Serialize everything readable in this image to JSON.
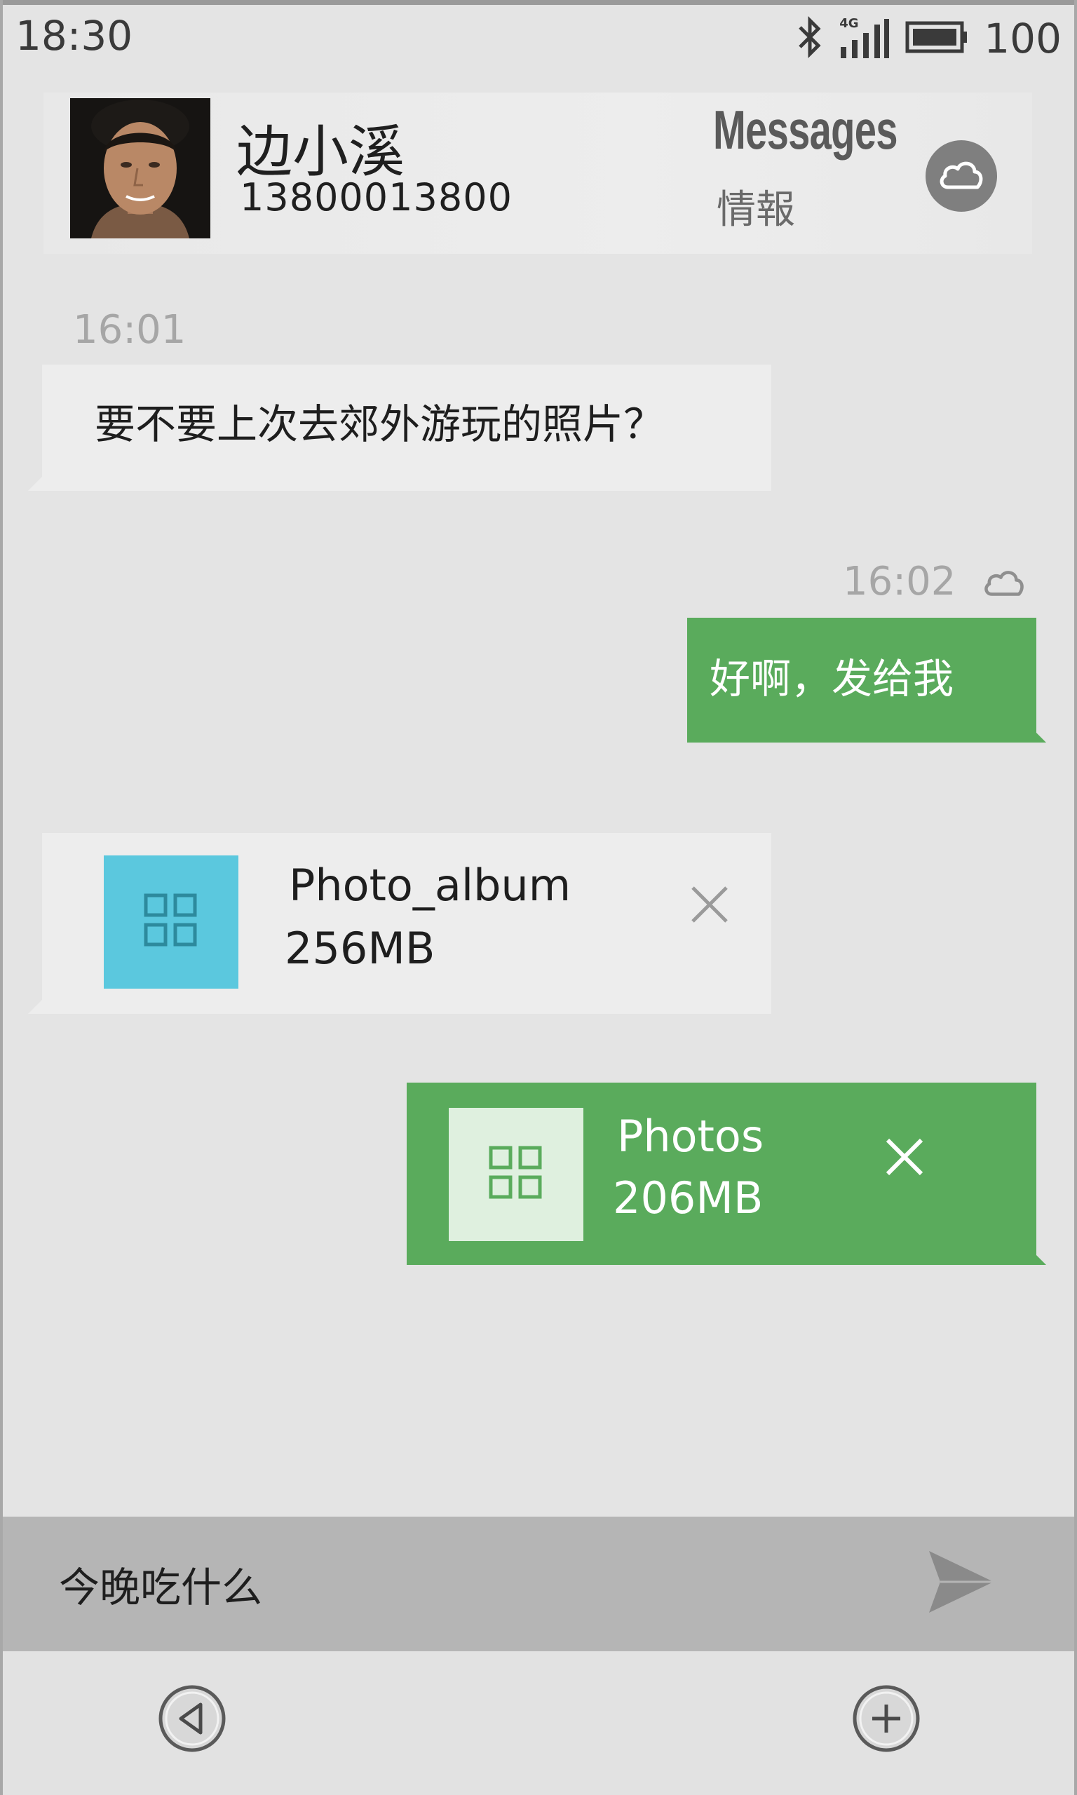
{
  "status_bar": {
    "time": "18:30",
    "network": "4G",
    "battery": "100",
    "icons": [
      "bluetooth-icon",
      "signal-icon",
      "battery-icon"
    ]
  },
  "header": {
    "contact_name": "边小溪",
    "contact_number": "13800013800",
    "app_title": "Messages",
    "app_subtitle": "情報",
    "cloud_icon": "cloud-icon"
  },
  "messages": [
    {
      "time": "16:01",
      "direction": "incoming",
      "text": "要不要上次去郊外游玩的照片？"
    },
    {
      "time": "16:02",
      "direction": "outgoing",
      "text": "好啊，发给我",
      "status_icon": "cloud-icon"
    },
    {
      "direction": "incoming",
      "type": "file",
      "file_name": "Photo_album",
      "file_size": "256MB",
      "thumb_icon": "grid-icon",
      "thumb_color": "#5bc8de"
    },
    {
      "direction": "outgoing",
      "type": "file",
      "file_name": "Photos",
      "file_size": "206MB",
      "thumb_icon": "grid-icon",
      "thumb_color": "#dff0df"
    }
  ],
  "input": {
    "value": "今晚吃什么",
    "send_icon": "send-icon"
  },
  "bottom_nav": {
    "back_icon": "back-icon",
    "add_icon": "add-icon"
  },
  "colors": {
    "outgoing_bubble": "#5aab5c",
    "incoming_bubble": "#ededed",
    "background": "#e4e4e4",
    "input_bar": "#b5b5b5"
  }
}
